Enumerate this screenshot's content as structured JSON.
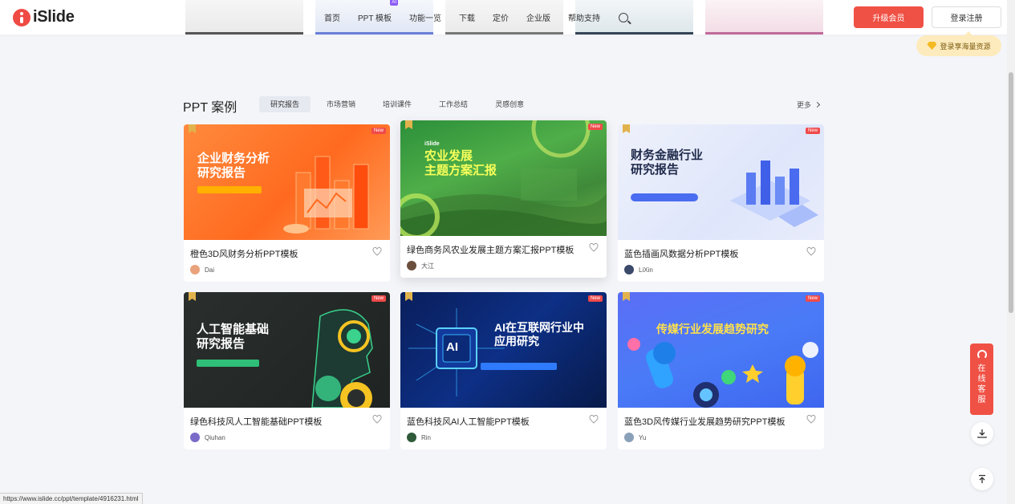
{
  "header": {
    "logo_text": "iSlide",
    "nav": [
      {
        "label": "首页"
      },
      {
        "label": "PPT 模板",
        "badge": "AI"
      },
      {
        "label": "功能一览"
      },
      {
        "label": "下载"
      },
      {
        "label": "定价"
      },
      {
        "label": "企业版"
      },
      {
        "label": "帮助支持"
      }
    ],
    "upgrade_label": "升级会员",
    "login_label": "登录注册",
    "promo_tip": "登录享海量资源"
  },
  "section": {
    "title": "PPT 案例",
    "tabs": [
      "研究报告",
      "市场营销",
      "培训课件",
      "工作总结",
      "灵感创意"
    ],
    "active_tab": "研究报告",
    "more_label": "更多"
  },
  "cards": [
    {
      "title": "橙色3D风财务分析PPT模板",
      "author": "Dai",
      "badge": "New",
      "thumb_heading": "企业财务分析\n研究报告"
    },
    {
      "title": "绿色商务风农业发展主题方案汇报PPT模板",
      "author": "大江",
      "badge": "New",
      "thumb_heading": "农业发展\n主题方案汇报",
      "thumb_brand": "iSlide"
    },
    {
      "title": "蓝色插画风数据分析PPT模板",
      "author": "LiXin",
      "badge": "New",
      "thumb_heading": "财务金融行业\n研究报告"
    },
    {
      "title": "绿色科技风人工智能基础PPT模板",
      "author": "Qiuhan",
      "badge": "New",
      "thumb_heading": "人工智能基础\n研究报告"
    },
    {
      "title": "蓝色科技风AI人工智能PPT模板",
      "author": "Rin",
      "badge": "New",
      "thumb_heading": "AI在互联网行业中\n应用研究",
      "thumb_chip": "AI"
    },
    {
      "title": "蓝色3D风传媒行业发展趋势研究PPT模板",
      "author": "Yu",
      "badge": "New",
      "thumb_heading": "传媒行业发展趋势研究"
    }
  ],
  "side": {
    "customer_service": [
      "在",
      "线",
      "客",
      "服"
    ]
  },
  "status_url": "https://www.islide.cc/ppt/template/4916231.html",
  "colors": {
    "brand_red": "#f05145",
    "page_bg": "#f4f5f9"
  }
}
